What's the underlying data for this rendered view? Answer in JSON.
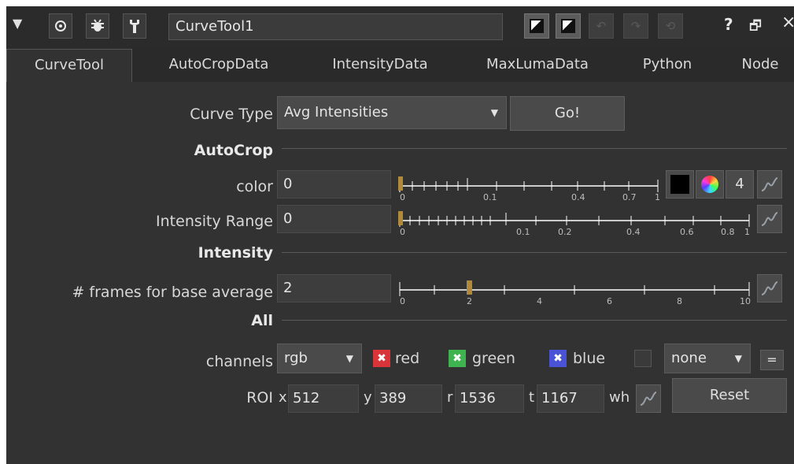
{
  "node": {
    "name": "CurveTool1"
  },
  "titlebar": {
    "collapse_glyph": "▼",
    "help_glyph": "?",
    "float_glyph": "🗗",
    "close_glyph": "×"
  },
  "tabs": [
    "CurveTool",
    "AutoCropData",
    "IntensityData",
    "MaxLumaData",
    "Python",
    "Node"
  ],
  "active_tab": "CurveTool",
  "controls": {
    "curve_type": {
      "label": "Curve Type",
      "value": "Avg Intensities"
    },
    "go_label": "Go!",
    "autocrop_header": "AutoCrop",
    "color": {
      "label": "color",
      "value": "0",
      "ticks": [
        "0",
        "0.1",
        "0.4",
        "0.7",
        "1"
      ],
      "channel_count": "4"
    },
    "intensity_range": {
      "label": "Intensity Range",
      "value": "0",
      "ticks": [
        "0",
        "0.1",
        "0.2",
        "0.4",
        "0.6",
        "0.8",
        "1"
      ]
    },
    "intensity_header": "Intensity",
    "frames": {
      "label": "# frames for base average",
      "value": "2",
      "ticks": [
        "0",
        "2",
        "4",
        "6",
        "8",
        "10"
      ]
    },
    "all_header": "All",
    "channels": {
      "label": "channels",
      "value": "rgb",
      "red": "red",
      "green": "green",
      "blue": "blue",
      "alpha": "none",
      "eq": "="
    },
    "roi": {
      "label": "ROI",
      "x_label": "x",
      "x": "512",
      "y_label": "y",
      "y": "389",
      "r_label": "r",
      "r": "1536",
      "t_label": "t",
      "t": "1167",
      "wh": "wh",
      "reset": "Reset"
    }
  },
  "colors": {
    "panel_bg": "#323232",
    "slider_handle": "#b08a3a",
    "check_red": "#d9343a",
    "check_green": "#3fb34f",
    "check_blue": "#4a52d6"
  },
  "icons": [
    "collapse-triangle",
    "target-icon",
    "bug-icon",
    "wrench-icon",
    "contrast-icon",
    "undo-icon",
    "redo-icon",
    "revert-icon",
    "help-icon",
    "float-icon",
    "close-icon",
    "curve-icon",
    "color-wheel-icon",
    "eyedropper-swatch-icon"
  ]
}
